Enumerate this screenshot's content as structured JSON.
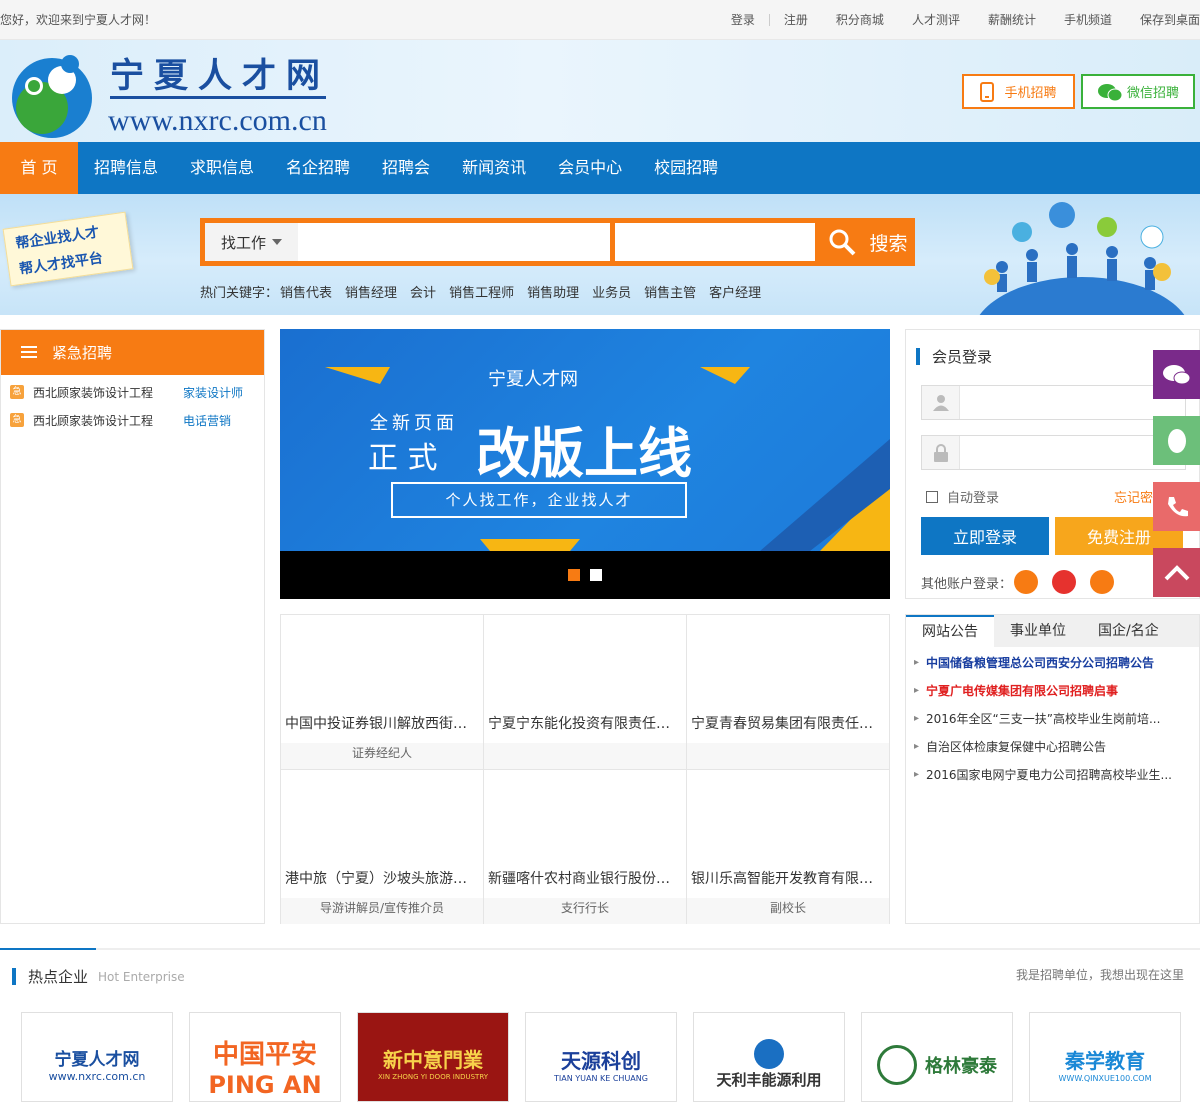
{
  "topbar": {
    "welcome": "您好，欢迎来到宁夏人才网！",
    "links": [
      "登录",
      "注册",
      "积分商城",
      "人才测评",
      "薪酬统计",
      "手机频道",
      "保存到桌面"
    ]
  },
  "header": {
    "logo_title": "宁夏人才网",
    "logo_url": "www.nxrc.com.cn",
    "mobile_btn": "手机招聘",
    "wechat_btn": "微信招聘"
  },
  "nav": [
    "首 页",
    "招聘信息",
    "求职信息",
    "名企招聘",
    "招聘会",
    "新闻资讯",
    "会员中心",
    "校园招聘"
  ],
  "search": {
    "type_label": "找工作",
    "button": "搜索",
    "slogan_line1": "帮企业找人才",
    "slogan_line2": "帮人才找平台",
    "hot_label": "热门关键字：",
    "hot_keywords": [
      "销售代表",
      "销售经理",
      "会计",
      "销售工程师",
      "销售助理",
      "业务员",
      "销售主管",
      "客户经理"
    ]
  },
  "urgent": {
    "title": "紧急招聘",
    "items": [
      {
        "company": "西北顾家装饰设计工程",
        "job": "家装设计师"
      },
      {
        "company": "西北顾家装饰设计工程",
        "job": "电话营销"
      }
    ]
  },
  "banner": {
    "site": "宁夏人才网",
    "line_small_a": "全新页面",
    "line_small_b": "正  式",
    "headline": "改版上线",
    "tagline": "个人找工作，企业找人才"
  },
  "companies": [
    {
      "name": "中国中投证券银川解放西街营...",
      "job": "证券经纪人"
    },
    {
      "name": "宁夏宁东能化投资有限责任公司",
      "job": ""
    },
    {
      "name": "宁夏青春贸易集团有限责任公司",
      "job": ""
    },
    {
      "name": "港中旅（宁夏）沙坡头旅游景...",
      "job": "导游讲解员/宣传推介员"
    },
    {
      "name": "新疆喀什农村商业银行股份有...",
      "job": "支行行长"
    },
    {
      "name": "银川乐高智能开发教育有限公司",
      "job": "副校长"
    }
  ],
  "login": {
    "title": "会员登录",
    "auto_login": "自动登录",
    "forgot": "忘记密码",
    "login_btn": "立即登录",
    "register_btn": "免费注册",
    "other_login": "其他账户登录："
  },
  "notice": {
    "tabs": [
      "网站公告",
      "事业单位",
      "国企/名企"
    ],
    "items": [
      {
        "text": "中国储备粮管理总公司西安分公司招聘公告",
        "color": "#1a3fa0"
      },
      {
        "text": "宁夏广电传媒集团有限公司招聘启事",
        "color": "#e02020"
      },
      {
        "text": "2016年全区“三支一扶”高校毕业生岗前培...",
        "color": "#333333"
      },
      {
        "text": "自治区体检康复保健中心招聘公告",
        "color": "#333333"
      },
      {
        "text": "2016国家电网宁夏电力公司招聘高校毕业生...",
        "color": "#333333"
      }
    ]
  },
  "hot_enterprise": {
    "title": "热点企业",
    "subtitle": "Hot Enterprise",
    "right_text": "我是招聘单位，我想出现在这里",
    "logos": [
      {
        "text": "宁夏人才网",
        "sub": "www.nxrc.com.cn"
      },
      {
        "text": "中国平安",
        "sub": "PING AN"
      },
      {
        "text": "新中意門業",
        "sub": "XIN ZHONG YI DOOR INDUSTRY"
      },
      {
        "text": "天源科创",
        "sub": "TIAN YUAN KE CHUANG"
      },
      {
        "text": "天利丰能源利用",
        "sub": ""
      },
      {
        "text": "格林豪泰",
        "sub": ""
      },
      {
        "text": "秦学教育",
        "sub": "WWW.QINXUE100.COM"
      }
    ]
  },
  "colors": {
    "brand_blue": "#0e76c4",
    "brand_orange": "#f77b13",
    "wechat_green": "#3ab13a"
  }
}
